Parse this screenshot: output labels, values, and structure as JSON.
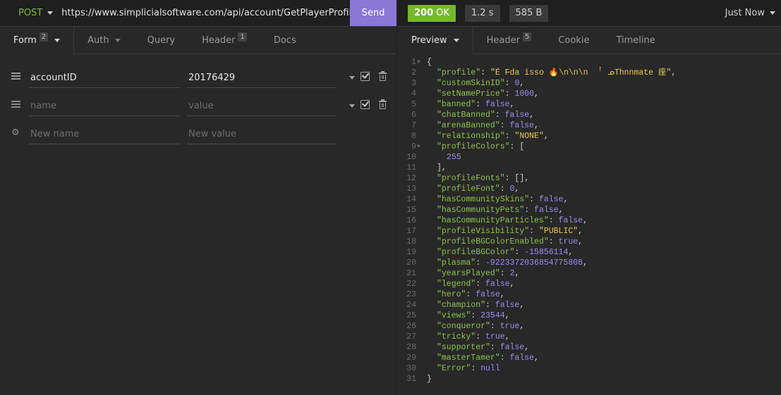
{
  "request": {
    "method": "POST",
    "url": "https://www.simplicialsoftware.com/api/account/GetPlayerProfile",
    "send_label": "Send",
    "tabs": [
      {
        "label": "Form",
        "badge": "2",
        "active": true,
        "caret": true
      },
      {
        "label": "Auth",
        "badge": null,
        "active": false,
        "caret": true
      },
      {
        "label": "Query",
        "badge": null,
        "active": false,
        "caret": false
      },
      {
        "label": "Header",
        "badge": "1",
        "active": false,
        "caret": false
      },
      {
        "label": "Docs",
        "badge": null,
        "active": false,
        "caret": false
      }
    ],
    "form_rows": [
      {
        "name": "accountID",
        "value": "20176429",
        "name_placeholder": "name",
        "value_placeholder": "value"
      },
      {
        "name": "",
        "value": "",
        "name_placeholder": "name",
        "value_placeholder": "value"
      },
      {
        "name": "",
        "value": "",
        "name_placeholder": "New name",
        "value_placeholder": "New value"
      }
    ]
  },
  "response": {
    "status_code": "200",
    "status_text": "OK",
    "time": "1.2 s",
    "size": "585 B",
    "history_label": "Just Now",
    "tabs": [
      {
        "label": "Preview",
        "badge": null,
        "active": true,
        "caret": true
      },
      {
        "label": "Header",
        "badge": "5",
        "active": false,
        "caret": false
      },
      {
        "label": "Cookie",
        "badge": null,
        "active": false,
        "caret": false
      },
      {
        "label": "Timeline",
        "badge": null,
        "active": false,
        "caret": false
      }
    ],
    "body_lines": [
      {
        "n": "1",
        "fold": true,
        "indent": 0,
        "parts": [
          [
            "p",
            "{"
          ]
        ]
      },
      {
        "n": "2",
        "indent": 1,
        "parts": [
          [
            "k",
            "\"profile\""
          ],
          [
            "p",
            ": "
          ],
          [
            "s",
            "\"É Fda isso 🔥\\n\\n\\n  ꜝ ᓄThnnmate 座\""
          ],
          [
            "p",
            ","
          ]
        ]
      },
      {
        "n": "3",
        "indent": 1,
        "parts": [
          [
            "k",
            "\"customSkinID\""
          ],
          [
            "p",
            ": "
          ],
          [
            "n",
            "0"
          ],
          [
            "p",
            ","
          ]
        ]
      },
      {
        "n": "4",
        "indent": 1,
        "parts": [
          [
            "k",
            "\"setNamePrice\""
          ],
          [
            "p",
            ": "
          ],
          [
            "n",
            "1000"
          ],
          [
            "p",
            ","
          ]
        ]
      },
      {
        "n": "5",
        "indent": 1,
        "parts": [
          [
            "k",
            "\"banned\""
          ],
          [
            "p",
            ": "
          ],
          [
            "n",
            "false"
          ],
          [
            "p",
            ","
          ]
        ]
      },
      {
        "n": "6",
        "indent": 1,
        "parts": [
          [
            "k",
            "\"chatBanned\""
          ],
          [
            "p",
            ": "
          ],
          [
            "n",
            "false"
          ],
          [
            "p",
            ","
          ]
        ]
      },
      {
        "n": "7",
        "indent": 1,
        "parts": [
          [
            "k",
            "\"arenaBanned\""
          ],
          [
            "p",
            ": "
          ],
          [
            "n",
            "false"
          ],
          [
            "p",
            ","
          ]
        ]
      },
      {
        "n": "8",
        "indent": 1,
        "parts": [
          [
            "k",
            "\"relationship\""
          ],
          [
            "p",
            ": "
          ],
          [
            "s",
            "\"NONE\""
          ],
          [
            "p",
            ","
          ]
        ]
      },
      {
        "n": "9",
        "fold": true,
        "indent": 1,
        "parts": [
          [
            "k",
            "\"profileColors\""
          ],
          [
            "p",
            ": ["
          ]
        ]
      },
      {
        "n": "10",
        "indent": 2,
        "parts": [
          [
            "n",
            "255"
          ]
        ]
      },
      {
        "n": "11",
        "indent": 1,
        "parts": [
          [
            "p",
            "],"
          ]
        ]
      },
      {
        "n": "12",
        "indent": 1,
        "parts": [
          [
            "k",
            "\"profileFonts\""
          ],
          [
            "p",
            ": [],"
          ]
        ]
      },
      {
        "n": "13",
        "indent": 1,
        "parts": [
          [
            "k",
            "\"profileFont\""
          ],
          [
            "p",
            ": "
          ],
          [
            "n",
            "0"
          ],
          [
            "p",
            ","
          ]
        ]
      },
      {
        "n": "14",
        "indent": 1,
        "parts": [
          [
            "k",
            "\"hasCommunitySkins\""
          ],
          [
            "p",
            ": "
          ],
          [
            "n",
            "false"
          ],
          [
            "p",
            ","
          ]
        ]
      },
      {
        "n": "15",
        "indent": 1,
        "parts": [
          [
            "k",
            "\"hasCommunityPets\""
          ],
          [
            "p",
            ": "
          ],
          [
            "n",
            "false"
          ],
          [
            "p",
            ","
          ]
        ]
      },
      {
        "n": "16",
        "indent": 1,
        "parts": [
          [
            "k",
            "\"hasCommunityParticles\""
          ],
          [
            "p",
            ": "
          ],
          [
            "n",
            "false"
          ],
          [
            "p",
            ","
          ]
        ]
      },
      {
        "n": "17",
        "indent": 1,
        "parts": [
          [
            "k",
            "\"profileVisibility\""
          ],
          [
            "p",
            ": "
          ],
          [
            "s",
            "\"PUBLIC\""
          ],
          [
            "p",
            ","
          ]
        ]
      },
      {
        "n": "18",
        "indent": 1,
        "parts": [
          [
            "k",
            "\"profileBGColorEnabled\""
          ],
          [
            "p",
            ": "
          ],
          [
            "n",
            "true"
          ],
          [
            "p",
            ","
          ]
        ]
      },
      {
        "n": "19",
        "indent": 1,
        "parts": [
          [
            "k",
            "\"profileBGColor\""
          ],
          [
            "p",
            ": "
          ],
          [
            "n",
            "-15856114"
          ],
          [
            "p",
            ","
          ]
        ]
      },
      {
        "n": "20",
        "indent": 1,
        "parts": [
          [
            "k",
            "\"plasma\""
          ],
          [
            "p",
            ": "
          ],
          [
            "n",
            "-9223372036854775808"
          ],
          [
            "p",
            ","
          ]
        ]
      },
      {
        "n": "21",
        "indent": 1,
        "parts": [
          [
            "k",
            "\"yearsPlayed\""
          ],
          [
            "p",
            ": "
          ],
          [
            "n",
            "2"
          ],
          [
            "p",
            ","
          ]
        ]
      },
      {
        "n": "22",
        "indent": 1,
        "parts": [
          [
            "k",
            "\"legend\""
          ],
          [
            "p",
            ": "
          ],
          [
            "n",
            "false"
          ],
          [
            "p",
            ","
          ]
        ]
      },
      {
        "n": "23",
        "indent": 1,
        "parts": [
          [
            "k",
            "\"hero\""
          ],
          [
            "p",
            ": "
          ],
          [
            "n",
            "false"
          ],
          [
            "p",
            ","
          ]
        ]
      },
      {
        "n": "24",
        "indent": 1,
        "parts": [
          [
            "k",
            "\"champion\""
          ],
          [
            "p",
            ": "
          ],
          [
            "n",
            "false"
          ],
          [
            "p",
            ","
          ]
        ]
      },
      {
        "n": "25",
        "indent": 1,
        "parts": [
          [
            "k",
            "\"views\""
          ],
          [
            "p",
            ": "
          ],
          [
            "n",
            "23544"
          ],
          [
            "p",
            ","
          ]
        ]
      },
      {
        "n": "26",
        "indent": 1,
        "parts": [
          [
            "k",
            "\"conqueror\""
          ],
          [
            "p",
            ": "
          ],
          [
            "n",
            "true"
          ],
          [
            "p",
            ","
          ]
        ]
      },
      {
        "n": "27",
        "indent": 1,
        "parts": [
          [
            "k",
            "\"tricky\""
          ],
          [
            "p",
            ": "
          ],
          [
            "n",
            "true"
          ],
          [
            "p",
            ","
          ]
        ]
      },
      {
        "n": "28",
        "indent": 1,
        "parts": [
          [
            "k",
            "\"supporter\""
          ],
          [
            "p",
            ": "
          ],
          [
            "n",
            "false"
          ],
          [
            "p",
            ","
          ]
        ]
      },
      {
        "n": "29",
        "indent": 1,
        "parts": [
          [
            "k",
            "\"masterTamer\""
          ],
          [
            "p",
            ": "
          ],
          [
            "n",
            "false"
          ],
          [
            "p",
            ","
          ]
        ]
      },
      {
        "n": "30",
        "indent": 1,
        "parts": [
          [
            "k",
            "\"Error\""
          ],
          [
            "p",
            ": "
          ],
          [
            "n",
            "null"
          ]
        ]
      },
      {
        "n": "31",
        "indent": 0,
        "parts": [
          [
            "p",
            "}"
          ]
        ]
      }
    ]
  },
  "colors": {
    "send_button": "#8a78d6",
    "status_ok": "#75b82c",
    "method": "#7fb83c",
    "json_key": "#8bc34a",
    "json_string": "#e5c84a",
    "json_literal": "#9b8cf0"
  }
}
